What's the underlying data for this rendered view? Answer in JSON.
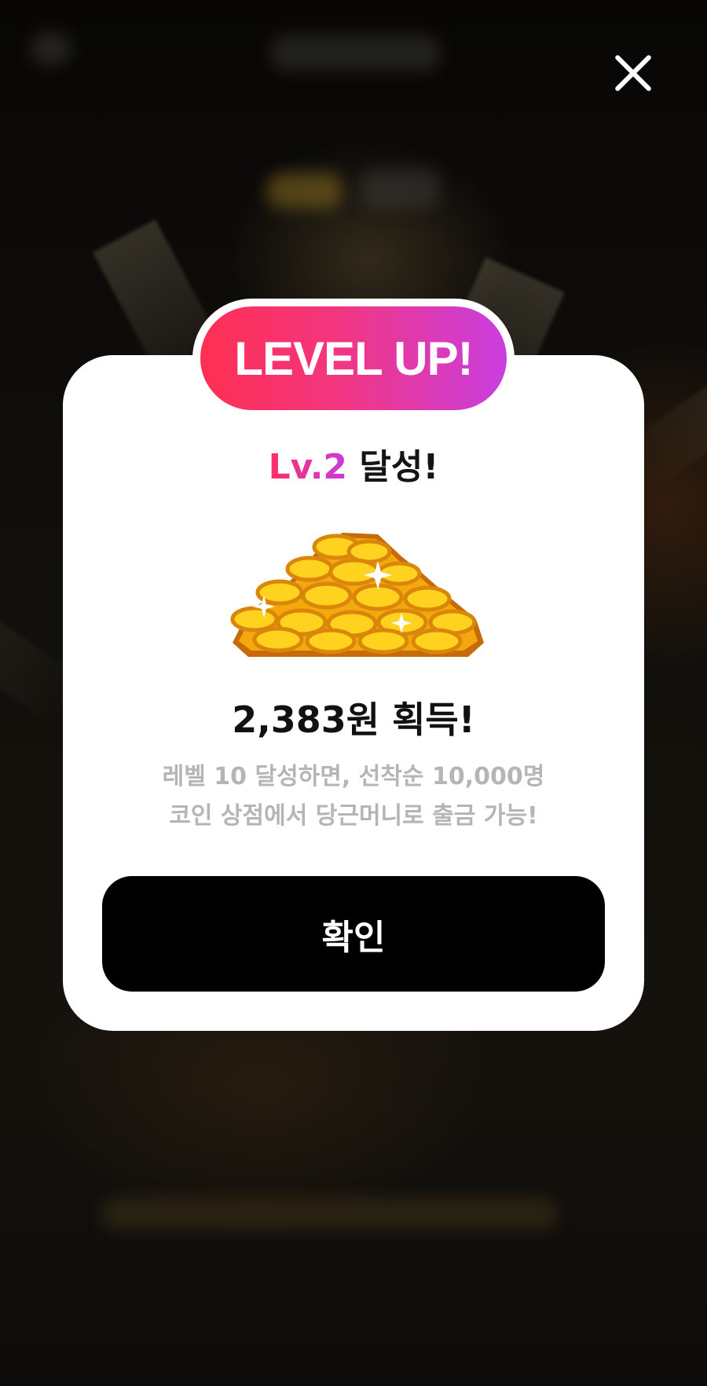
{
  "badge": {
    "text": "LEVEL UP!"
  },
  "level": {
    "prefix": "Lv.2",
    "suffix": " 달성!"
  },
  "reward": {
    "text": "2,383원 획득!"
  },
  "description": {
    "line1": "레벨 10 달성하면, 선착순 10,000명",
    "line2": "코인 상점에서 당근머니로 출금 가능!"
  },
  "confirm": {
    "label": "확인"
  },
  "icons": {
    "close": "close-icon",
    "coins": "gold-coin-pile-icon"
  },
  "colors": {
    "badge_gradient_start": "#ff2f52",
    "badge_gradient_end": "#c93ee0",
    "button_bg": "#000000",
    "description_text": "#b5b5b5"
  }
}
